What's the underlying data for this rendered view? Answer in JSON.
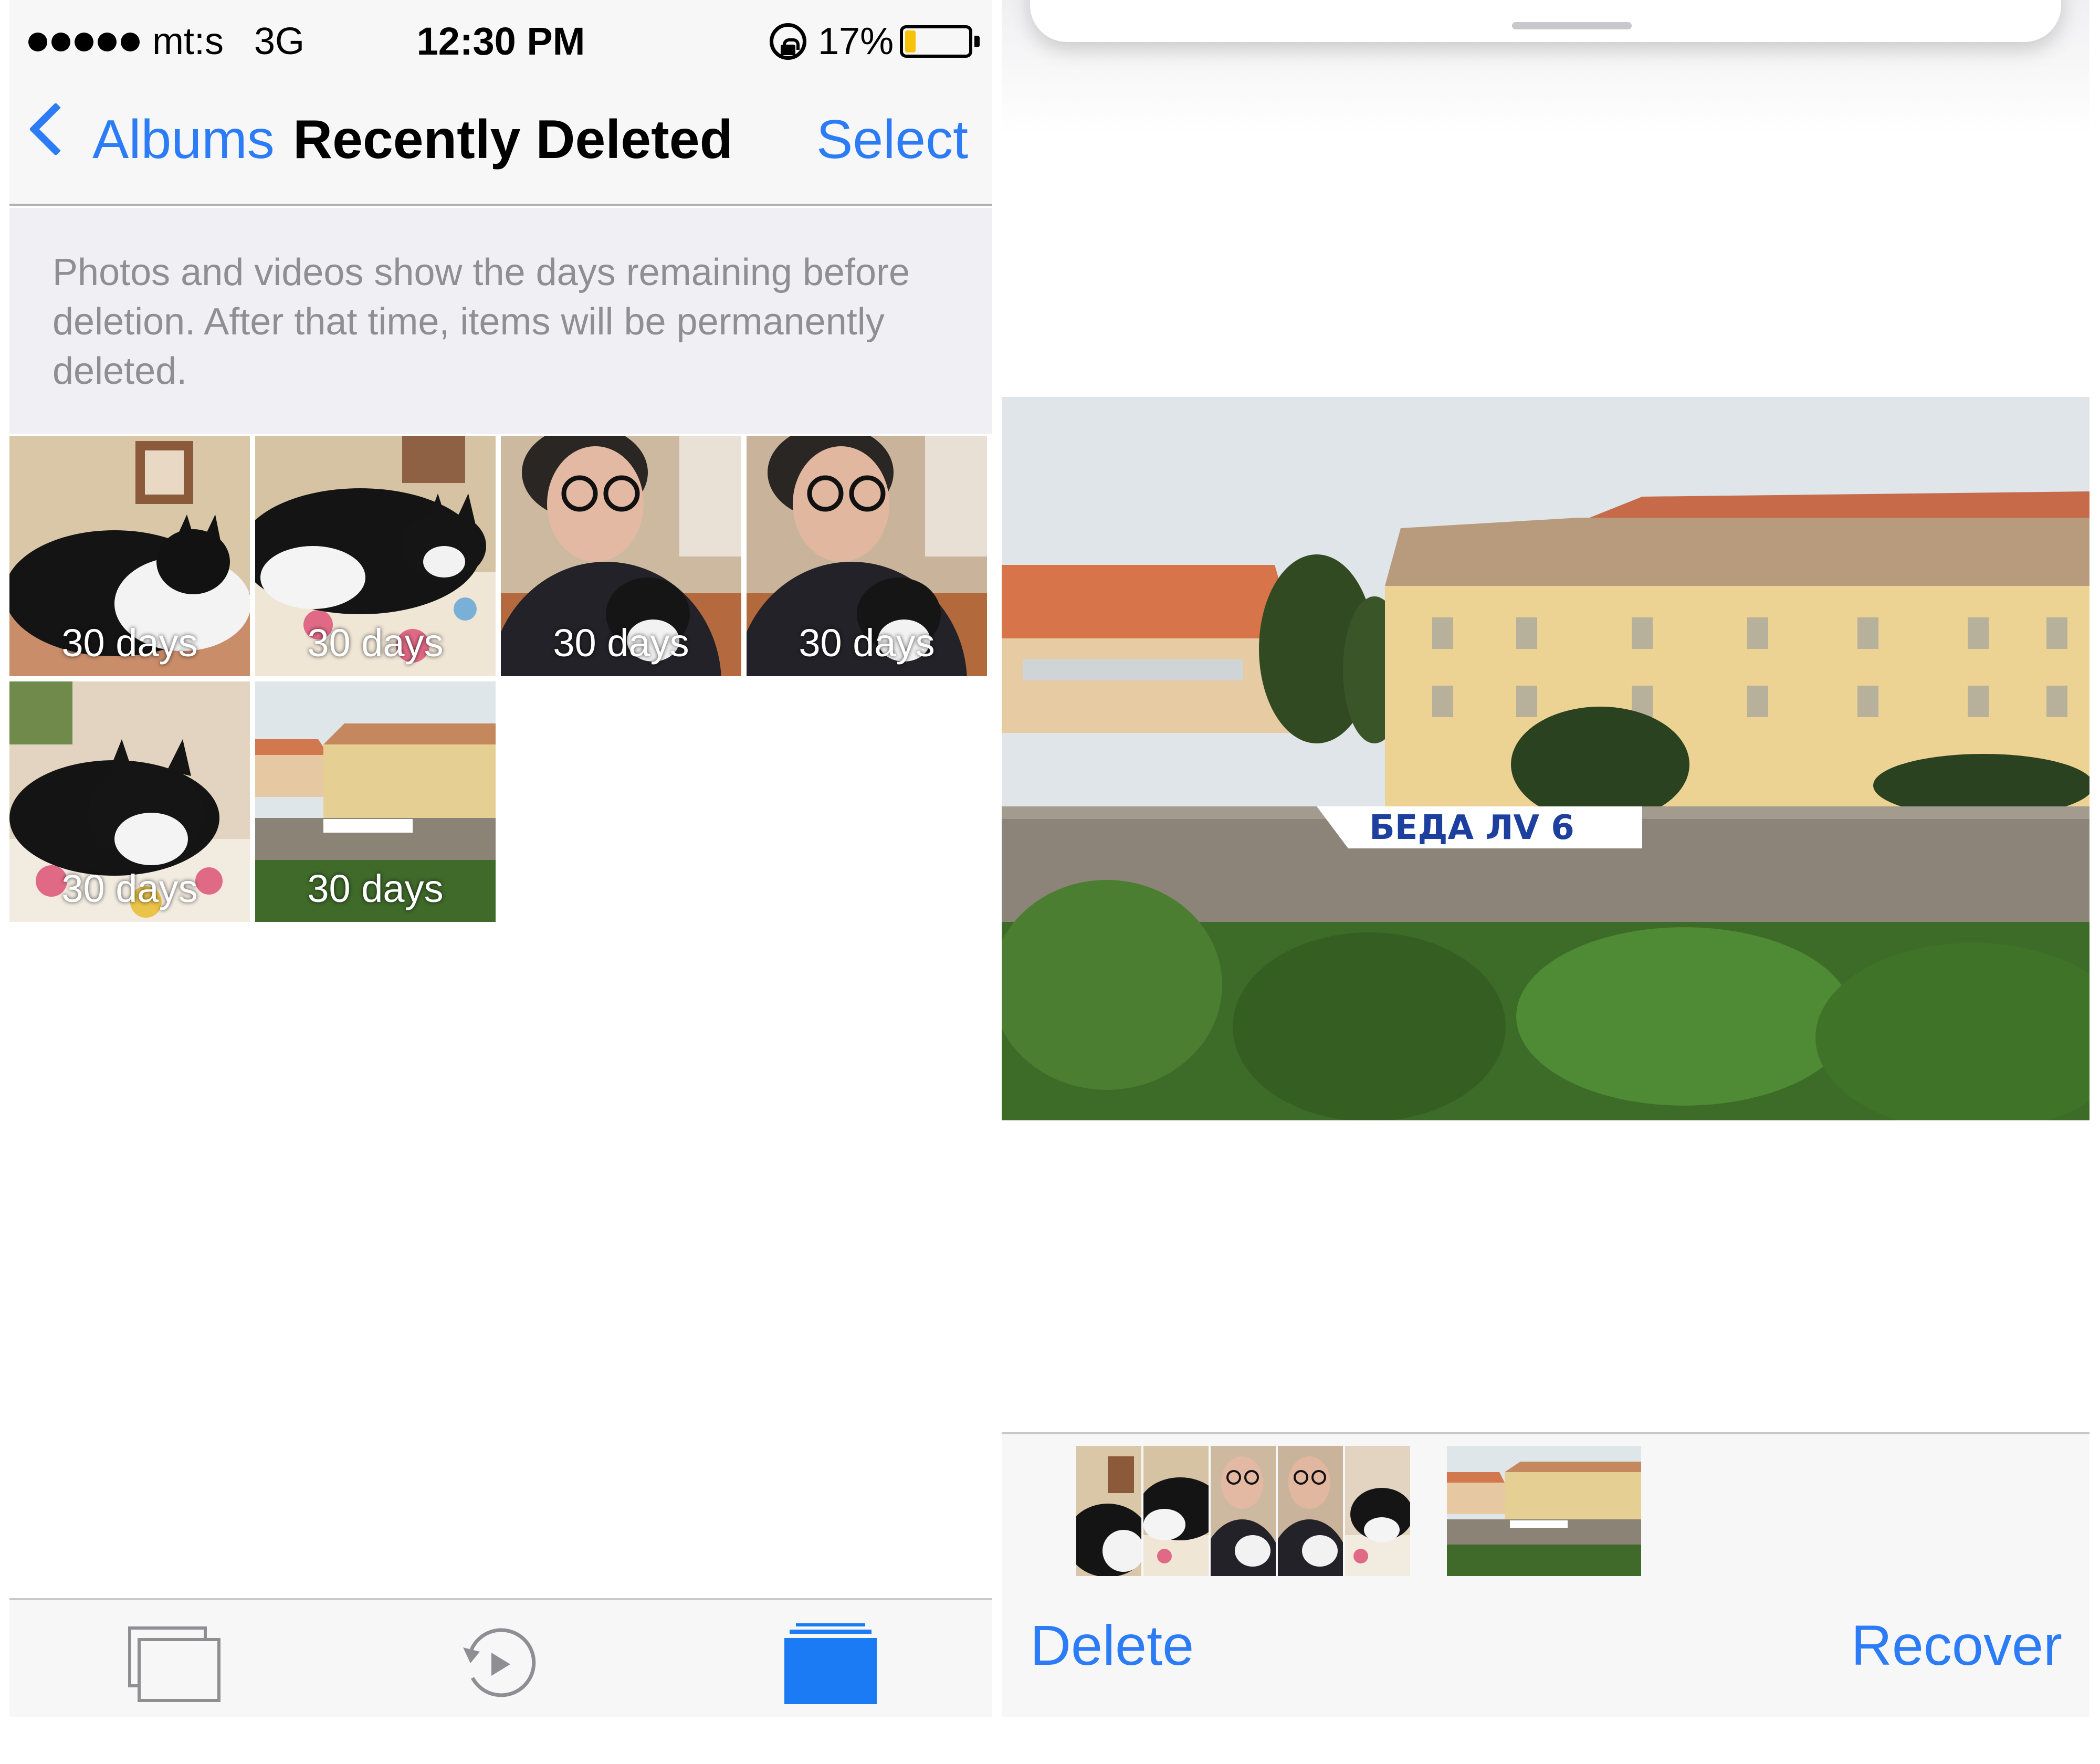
{
  "status_bar": {
    "carrier": "mt:s",
    "network": "3G",
    "time": "12:30 PM",
    "battery_percent": "17%",
    "battery_level": 0.17
  },
  "nav": {
    "back_label": "Albums",
    "title": "Recently Deleted",
    "select_label": "Select"
  },
  "info": {
    "text": "Photos and videos show the days remaining before deletion. After that time, items will be permanently deleted."
  },
  "grid": {
    "items": [
      {
        "days": "30 days",
        "subject": "cat"
      },
      {
        "days": "30 days",
        "subject": "cat"
      },
      {
        "days": "30 days",
        "subject": "person-with-cat"
      },
      {
        "days": "30 days",
        "subject": "person-with-cat"
      },
      {
        "days": "30 days",
        "subject": "cat"
      },
      {
        "days": "30 days",
        "subject": "castle"
      }
    ]
  },
  "tab_bar": {
    "tabs": [
      {
        "icon": "photos-stack-icon",
        "selected": false
      },
      {
        "icon": "memories-icon",
        "selected": false
      },
      {
        "icon": "albums-icon",
        "selected": true
      }
    ]
  },
  "viewer": {
    "banner_text": "БЕДА ЛV 6",
    "delete_label": "Delete",
    "recover_label": "Recover"
  },
  "colors": {
    "accent": "#2b7cf6",
    "battery_low": "#f6c20a"
  }
}
